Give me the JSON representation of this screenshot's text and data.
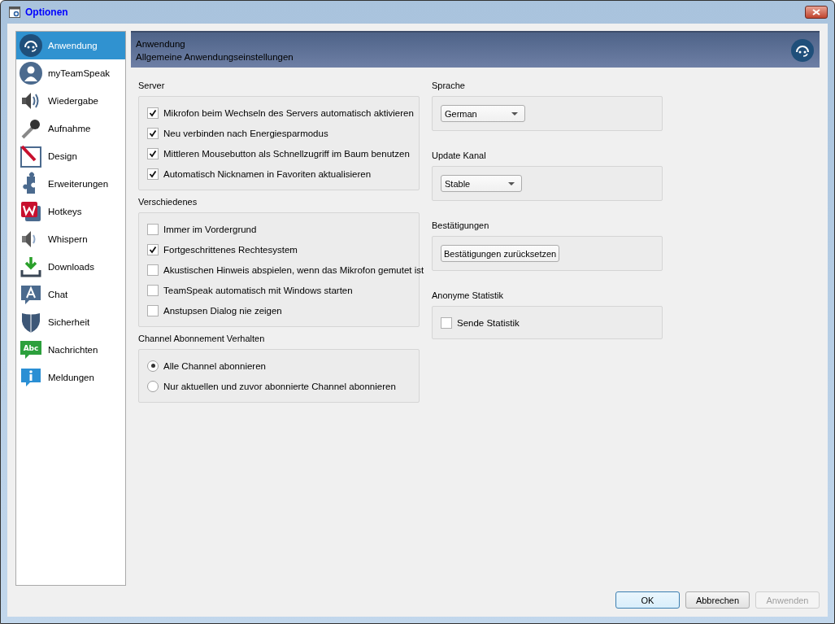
{
  "window": {
    "title": "Optionen"
  },
  "sidebar": {
    "items": [
      {
        "label": "Anwendung",
        "kind": "headset",
        "selected": true
      },
      {
        "label": "myTeamSpeak",
        "kind": "user",
        "selected": false
      },
      {
        "label": "Wiedergabe",
        "kind": "speaker",
        "selected": false
      },
      {
        "label": "Aufnahme",
        "kind": "mic",
        "selected": false
      },
      {
        "label": "Design",
        "kind": "pen",
        "selected": false
      },
      {
        "label": "Erweiterungen",
        "kind": "puzzle",
        "selected": false
      },
      {
        "label": "Hotkeys",
        "kind": "hotkey",
        "selected": false
      },
      {
        "label": "Whispern",
        "kind": "whisper",
        "selected": false
      },
      {
        "label": "Downloads",
        "kind": "download",
        "selected": false
      },
      {
        "label": "Chat",
        "kind": "chat",
        "selected": false
      },
      {
        "label": "Sicherheit",
        "kind": "shield",
        "selected": false
      },
      {
        "label": "Nachrichten",
        "kind": "message",
        "icon_text": "Abc",
        "selected": false
      },
      {
        "label": "Meldungen",
        "kind": "info",
        "selected": false
      }
    ]
  },
  "header": {
    "title": "Anwendung",
    "subtitle": "Allgemeine Anwendungseinstellungen"
  },
  "left_groups": [
    {
      "title": "Server",
      "kind": "checkboxes",
      "options": [
        {
          "label": "Mikrofon beim Wechseln des Servers automatisch aktivieren",
          "checked": true
        },
        {
          "label": "Neu verbinden nach Energiesparmodus",
          "checked": true
        },
        {
          "label": "Mittleren Mousebutton als Schnellzugriff im Baum benutzen",
          "checked": true
        },
        {
          "label": "Automatisch Nicknamen in Favoriten aktualisieren",
          "checked": true
        }
      ]
    },
    {
      "title": "Verschiedenes",
      "kind": "checkboxes",
      "options": [
        {
          "label": "Immer im Vordergrund",
          "checked": false
        },
        {
          "label": "Fortgeschrittenes Rechtesystem",
          "checked": true
        },
        {
          "label": "Akustischen Hinweis abspielen, wenn das Mikrofon gemutet ist",
          "checked": false
        },
        {
          "label": "TeamSpeak automatisch mit Windows starten",
          "checked": false
        },
        {
          "label": "Anstupsen Dialog nie zeigen",
          "checked": false
        }
      ]
    },
    {
      "title": "Channel Abonnement Verhalten",
      "kind": "radios",
      "options": [
        {
          "label": "Alle Channel abonnieren",
          "selected": true
        },
        {
          "label": "Nur aktuellen und zuvor abonnierte Channel abonnieren",
          "selected": false
        }
      ]
    }
  ],
  "right_groups": [
    {
      "title": "Sprache",
      "kind": "dropdown",
      "value": "German"
    },
    {
      "title": "Update Kanal",
      "kind": "dropdown",
      "value": "Stable"
    },
    {
      "title": "Bestätigungen",
      "kind": "button",
      "label": "Bestätigungen zurücksetzen"
    },
    {
      "title": "Anonyme Statistik",
      "kind": "checkbox",
      "label": "Sende Statistik",
      "checked": false
    }
  ],
  "buttons": [
    {
      "label": "OK",
      "kind": "default",
      "disabled": false
    },
    {
      "label": "Abbrechen",
      "kind": "normal",
      "disabled": false
    },
    {
      "label": "Anwenden",
      "kind": "normal",
      "disabled": true
    }
  ]
}
